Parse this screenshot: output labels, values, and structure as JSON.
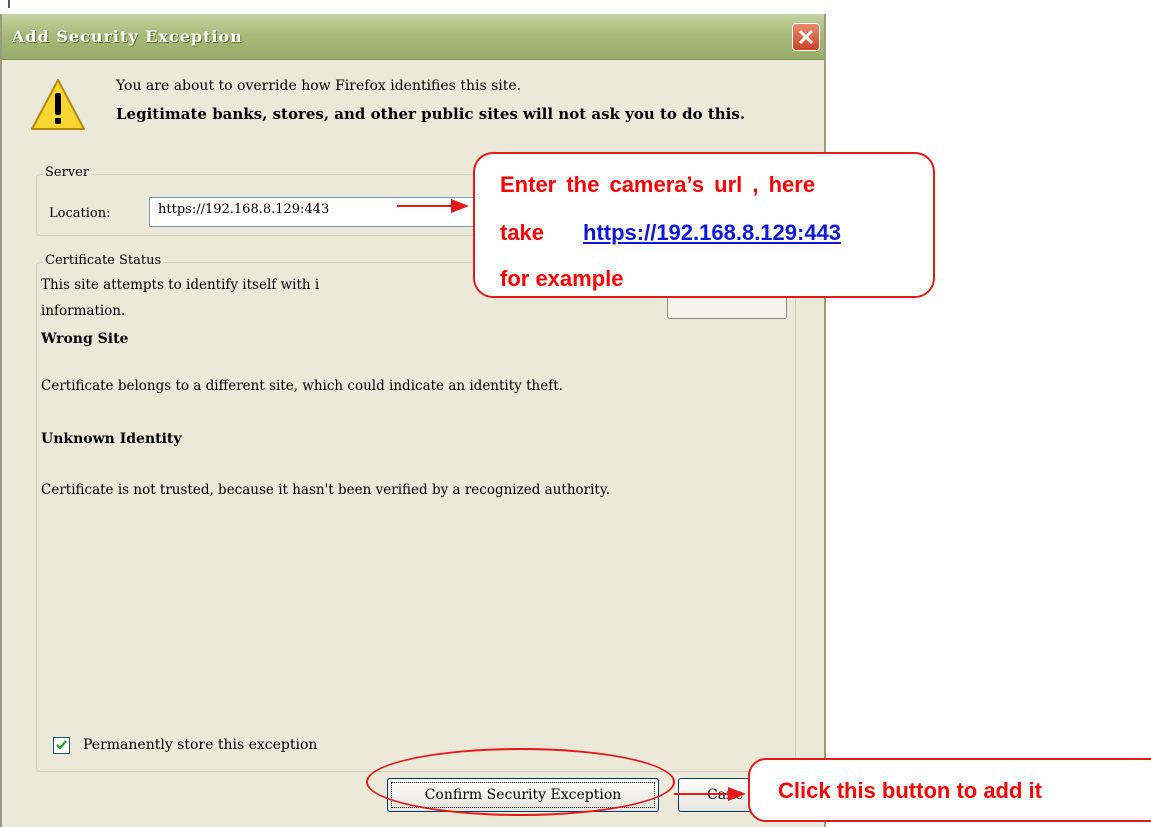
{
  "dialog": {
    "title": "Add Security Exception",
    "message_line1": "You are about to override how Firefox identifies this site.",
    "message_bold": "Legitimate banks, stores, and other public sites will not ask you to do this."
  },
  "server": {
    "group_label": "Server",
    "location_label": "Location:",
    "location_value": "https://192.168.8.129:443"
  },
  "certificate": {
    "group_label": "Certificate Status",
    "intro_line1": "This site attempts to identify itself with i",
    "intro_line2": "information.",
    "wrong_site_heading": "Wrong Site",
    "wrong_site_text": "Certificate belongs to a different site, which could indicate an identity theft.",
    "unknown_heading": "Unknown Identity",
    "unknown_text": "Certificate is not trusted, because it hasn't been verified by a recognized authority."
  },
  "permanent": {
    "label": "Permanently store this exception",
    "checked": true
  },
  "buttons": {
    "confirm": "Confirm Security Exception",
    "cancel": "Canc"
  },
  "annotations": {
    "callout1_line1": "Enter the camera’s url , here",
    "callout1_take": "take",
    "callout1_url": "https://192.168.8.129:443",
    "callout1_line3": "for example",
    "callout2": "Click this button to add it",
    "color": "#ff0000"
  }
}
